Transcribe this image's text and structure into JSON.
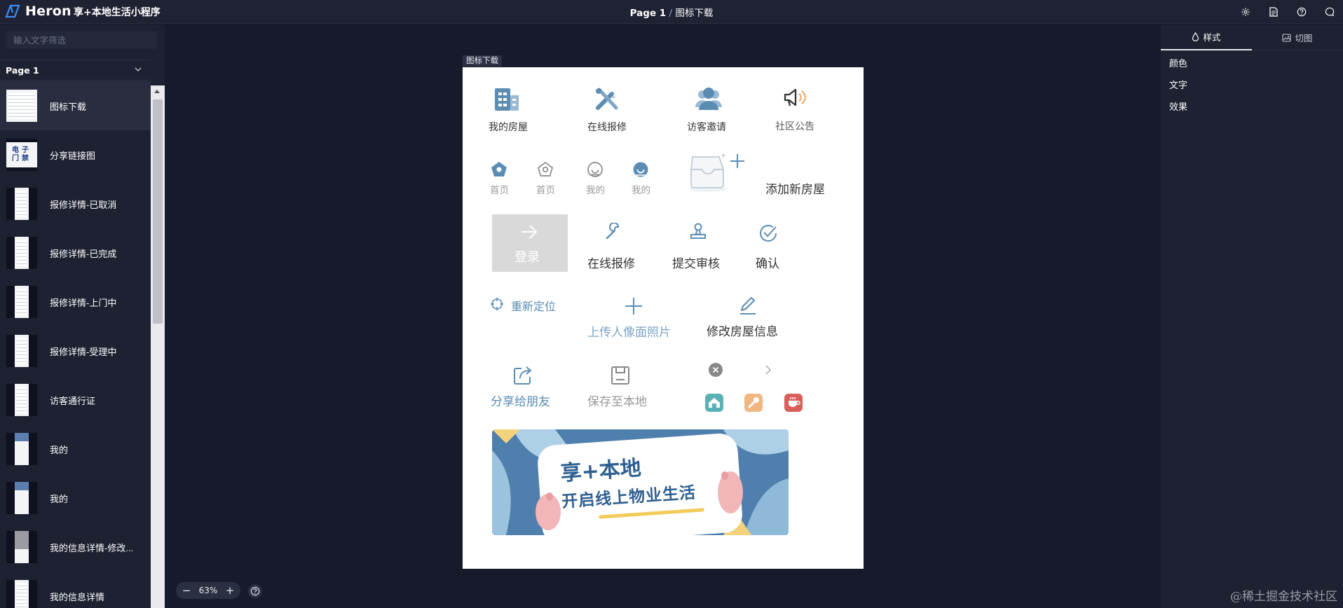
{
  "app": {
    "name": "Heron",
    "project": "享+本地生活小程序"
  },
  "breadcrumb": {
    "page": "Page 1",
    "separator": "/",
    "artboard": "图标下载"
  },
  "top_icons": [
    "gear-icon",
    "document-icon",
    "help-icon",
    "chat-icon"
  ],
  "sidebar": {
    "filter_placeholder": "输入文字筛选",
    "page_select": "Page 1",
    "items": [
      {
        "label": "图标下载",
        "active": true
      },
      {
        "label": "分享链接图"
      },
      {
        "label": "报修详情-已取消"
      },
      {
        "label": "报修详情-已完成"
      },
      {
        "label": "报修详情-上门中"
      },
      {
        "label": "报修详情-受理中"
      },
      {
        "label": "访客通行证"
      },
      {
        "label": "我的"
      },
      {
        "label": "我的"
      },
      {
        "label": "我的信息详情-修改..."
      },
      {
        "label": "我的信息详情"
      }
    ],
    "qr_thumb_text": "电子门禁"
  },
  "canvas": {
    "artboard_label": "图标下载",
    "zoom": "63%"
  },
  "artboard": {
    "row1": [
      "我的房屋",
      "在线报修",
      "访客邀请",
      "社区公告"
    ],
    "row2": [
      "首页",
      "首页",
      "我的",
      "我的",
      "添加新房屋"
    ],
    "row3": {
      "login": "登录",
      "labels": [
        "在线报修",
        "提交审核",
        "确认"
      ]
    },
    "row4": [
      "重新定位",
      "上传人像面照片",
      "修改房屋信息"
    ],
    "row5": [
      "分享给朋友",
      "保存至本地"
    ],
    "banner": {
      "line1": "享+本地",
      "line2": "开启线上物业生活"
    }
  },
  "right_panel": {
    "tabs": [
      "样式",
      "切图"
    ],
    "sections": [
      "颜色",
      "文字",
      "效果"
    ]
  },
  "watermark": "@稀土掘金技术社区",
  "colors": {
    "accent_blue": "#5b8db4",
    "icon_dark": "#333333",
    "login_bg": "#d9d9d9",
    "banner_blue": "#4f7fac"
  }
}
